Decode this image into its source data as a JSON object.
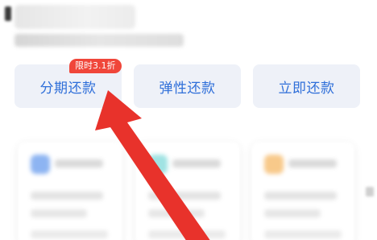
{
  "repay_options": {
    "installment_label": "分期还款",
    "flexible_label": "弹性还款",
    "immediate_label": "立即还款",
    "promo_badge": "限时3.1折"
  },
  "colors": {
    "button_text": "#2f6fd9",
    "button_bg": "#eef1f8",
    "badge_bg": "#f0463a",
    "arrow": "#e8322b"
  },
  "annotation": {
    "pointer": "red-arrow",
    "target": "installment-repay-button"
  }
}
